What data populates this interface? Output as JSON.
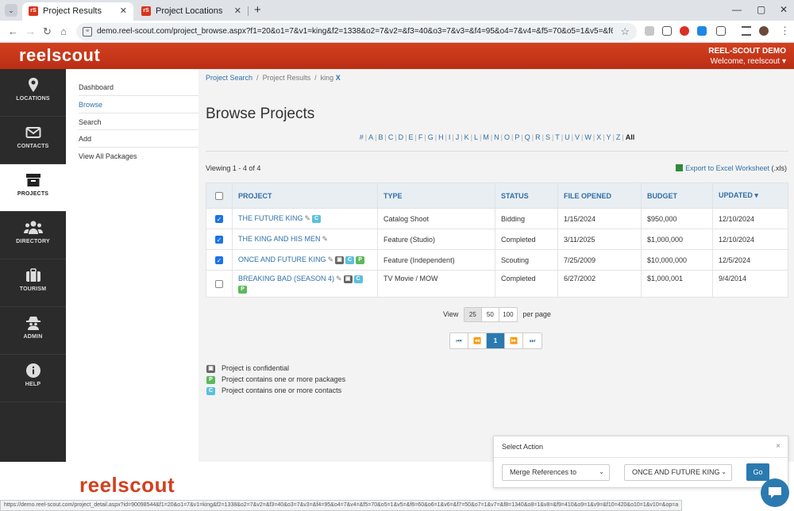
{
  "browser": {
    "tabs": [
      {
        "title": "Project Results",
        "active": true
      },
      {
        "title": "Project Locations",
        "active": false
      }
    ],
    "url": "demo.reel-scout.com/project_browse.aspx?f1=20&o1=7&v1=king&f2=1338&o2=7&v2=&f3=40&o3=7&v3=&f4=95&o4=7&v4=&f5=70&o5=1&v5=&f6=60&o6=1&v..."
  },
  "header": {
    "logo": "reelscout",
    "account": "REEL-SCOUT DEMO",
    "welcome": "Welcome, reelscout ▾"
  },
  "iconbar": [
    {
      "label": "LOCATIONS",
      "icon": "map-marker-icon"
    },
    {
      "label": "CONTACTS",
      "icon": "envelope-icon"
    },
    {
      "label": "PROJECTS",
      "icon": "archive-box-icon",
      "active": true
    },
    {
      "label": "DIRECTORY",
      "icon": "people-icon"
    },
    {
      "label": "TOURISM",
      "icon": "suitcase-icon"
    },
    {
      "label": "ADMIN",
      "icon": "spy-icon"
    },
    {
      "label": "HELP",
      "icon": "info-icon"
    }
  ],
  "subnav": [
    "Dashboard",
    "Browse",
    "Search",
    "Add",
    "View All Packages"
  ],
  "breadcrumb": {
    "search": "Project Search",
    "results": "Project Results",
    "filter": "king",
    "remove": "X"
  },
  "page_title": "Browse Projects",
  "alphabet": [
    "#",
    "A",
    "B",
    "C",
    "D",
    "E",
    "F",
    "G",
    "H",
    "I",
    "J",
    "K",
    "L",
    "M",
    "N",
    "O",
    "P",
    "Q",
    "R",
    "S",
    "T",
    "U",
    "V",
    "W",
    "X",
    "Y",
    "Z"
  ],
  "alphabet_all": "All",
  "viewing": "Viewing 1 - 4 of 4",
  "export": {
    "label": "Export to Excel Worksheet",
    "ext": "(.xls)"
  },
  "columns": [
    "PROJECT",
    "TYPE",
    "STATUS",
    "FILE OPENED",
    "BUDGET",
    "UPDATED ▾"
  ],
  "rows": [
    {
      "project": "THE FUTURE KING",
      "type": "Catalog Shoot",
      "status": "Bidding",
      "opened": "1/15/2024",
      "budget": "$950,000",
      "updated": "12/10/2024",
      "checked": true
    },
    {
      "project": "THE KING AND HIS MEN",
      "type": "Feature (Studio)",
      "status": "Completed",
      "opened": "3/11/2025",
      "budget": "$1,000,000",
      "updated": "12/10/2024",
      "checked": true
    },
    {
      "project": "ONCE AND FUTURE KING",
      "type": "Feature (Independent)",
      "status": "Scouting",
      "opened": "7/25/2009",
      "budget": "$10,000,000",
      "updated": "12/5/2024",
      "checked": true
    },
    {
      "project": "BREAKING BAD (SEASON 4)",
      "type": "TV Movie / MOW",
      "status": "Completed",
      "opened": "6/27/2002",
      "budget": "$1,000,001",
      "updated": "9/4/2014",
      "checked": false
    }
  ],
  "badges": {
    "c": "C",
    "p": "P"
  },
  "pagesize": {
    "label": "View",
    "options": [
      "25",
      "50",
      "100"
    ],
    "suffix": "per page"
  },
  "pager": {
    "first": "⏮",
    "prev": "⏪",
    "current": "1",
    "next": "⏩",
    "last": "⏭"
  },
  "legend": [
    {
      "key": "lock",
      "text": "Project is confidential"
    },
    {
      "key": "P",
      "text": "Project contains one or more packages"
    },
    {
      "key": "C",
      "text": "Project contains one or more contacts"
    }
  ],
  "action": {
    "title": "Select Action",
    "close": "×",
    "select1": "Merge References to",
    "select2": "ONCE AND FUTURE KING",
    "go": "Go"
  },
  "footer_logo": "reelscout",
  "status_url": "https://demo.reel-scout.com/project_detail.aspx?id=90098544&f1=20&o1=7&v1=king&f2=1338&o2=7&v2=&f3=40&o3=7&v3=&f4=95&o4=7&v4=&f5=70&o5=1&v5=&f6=60&o6=1&v6=&f7=50&o7=1&v7=&f8=1340&o8=1&v8=&f9=410&o9=1&v9=&f10=420&o10=1&v10=&op=a"
}
